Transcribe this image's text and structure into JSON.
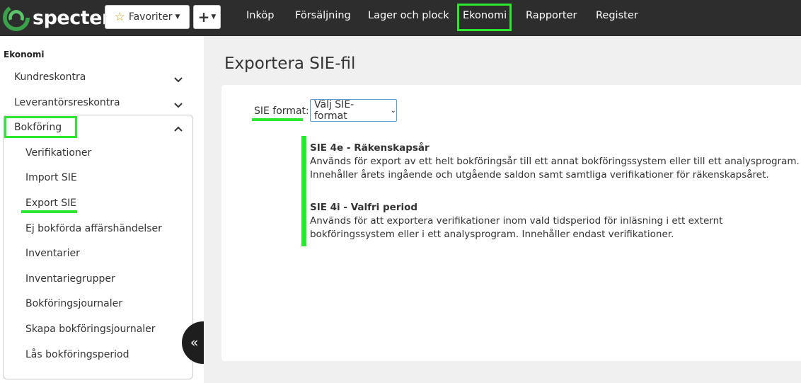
{
  "brand": {
    "name": "specter",
    "accent": "#2ee62e"
  },
  "toolbar": {
    "favorites_label": "Favoriter",
    "add_label": "+"
  },
  "nav": {
    "items": [
      "Inköp",
      "Försäljning",
      "Lager och plock",
      "Ekonomi",
      "Rapporter",
      "Register"
    ],
    "active": "Ekonomi"
  },
  "sidebar": {
    "title": "Ekonomi",
    "groups": [
      "Kundreskontra",
      "Leverantörsreskontra",
      "Bokföring"
    ],
    "bokforing_items": [
      "Verifikationer",
      "Import SIE",
      "Export SIE",
      "Ej bokförda affärshändelser",
      "Inventarier",
      "Inventariegrupper",
      "Bokföringsjournaler",
      "Skapa bokföringsjournaler",
      "Lås bokföringsperiod"
    ],
    "active_item": "Export SIE"
  },
  "main": {
    "title": "Exportera SIE-fil",
    "format_label": "SIE format:",
    "format_select": "Välj SIE-format",
    "options": [
      {
        "title": "SIE 4e - Räkenskapsår",
        "lines": [
          "Används för export av ett helt bokföringsår till ett annat bokföringssystem eller till ett analysprogram.",
          "Innehåller årets ingående och utgående saldon samt samtliga verifikationer för räkenskapsåret."
        ]
      },
      {
        "title": "SIE 4i - Valfri period",
        "lines": [
          "Används för att exportera verifikationer inom vald tidsperiod för inläsning i ett externt",
          "bokföringssystem eller i ett analysprogram. Innehåller endast verifikationer."
        ]
      }
    ]
  }
}
